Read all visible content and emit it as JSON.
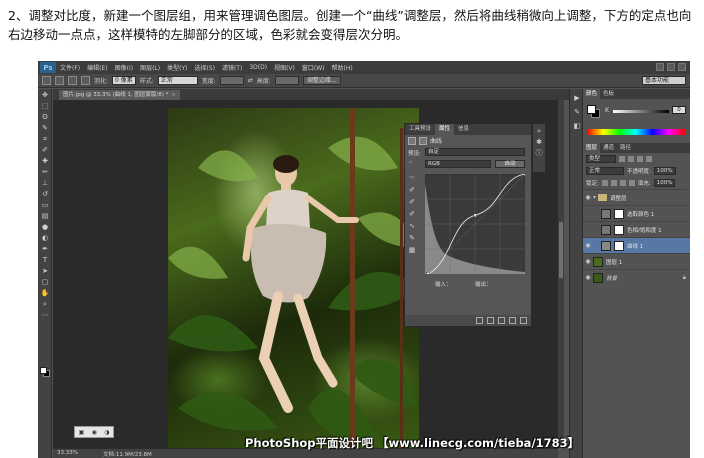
{
  "instruction": "2、调整对比度，新建一个图层组，用来管理调色图层。创建一个“曲线”调整层，然后将曲线稍微向上调整，下方的定点也向右边移动一点点，这样模特的左脚部分的区域，色彩就会变得层次分明。",
  "app": {
    "logo": "Ps",
    "menus": [
      "文件(F)",
      "编辑(E)",
      "图像(I)",
      "图层(L)",
      "类型(Y)",
      "选择(S)",
      "滤镜(T)",
      "3D(D)",
      "视图(V)",
      "窗口(W)",
      "帮助(H)"
    ],
    "workspace": "基本功能",
    "options": {
      "feather_label": "羽化:",
      "feather_value": "0 像素",
      "style_label": "样式:",
      "style_value": "正常",
      "width_label": "宽度:",
      "height_label": "高度:",
      "refine_button": "调整边缘..."
    }
  },
  "document": {
    "tab_title": "图片.jpg @ 33.3% (曲线 1, 图层蒙版/8) *",
    "zoom": "33.33%",
    "file_info": "文档:11.9M/23.8M"
  },
  "properties_panel": {
    "tabs": [
      "工具预设",
      "属性",
      "信息"
    ],
    "active_tab": "属性",
    "header": "曲线",
    "preset_label": "预设:",
    "preset_value": "自定",
    "channel_value": "RGB",
    "auto_button": "自动",
    "input_label": "输入：",
    "output_label": "输出："
  },
  "color_panel": {
    "tabs": [
      "颜色",
      "色板"
    ],
    "channel_label": "K",
    "channel_value": "0",
    "unit": "%"
  },
  "layers_panel": {
    "tabs": [
      "图层",
      "通道",
      "路径"
    ],
    "kind_filter": "类型",
    "blend_mode": "正常",
    "opacity_label": "不透明度:",
    "opacity_value": "100%",
    "lock_label": "锁定:",
    "fill_label": "填充:",
    "fill_value": "100%",
    "layers": [
      {
        "name": "调整层",
        "type": "group",
        "selected": false
      },
      {
        "name": "选取颜色 1",
        "type": "adjustment",
        "selected": false
      },
      {
        "name": "色相/饱和度 1",
        "type": "adjustment",
        "selected": false
      },
      {
        "name": "曲线 1",
        "type": "adjustment",
        "selected": true
      },
      {
        "name": "图层 1",
        "type": "pixel",
        "selected": false
      },
      {
        "name": "背景",
        "type": "background",
        "selected": false
      }
    ]
  },
  "curve": {
    "input_range": [
      0,
      255
    ],
    "output_range": [
      0,
      255
    ],
    "points": [
      [
        8,
        0
      ],
      [
        128,
        150
      ],
      [
        255,
        255
      ]
    ]
  },
  "watermark": "PhotoShop平面设计吧 【www.linecg.com/tieba/1783】"
}
